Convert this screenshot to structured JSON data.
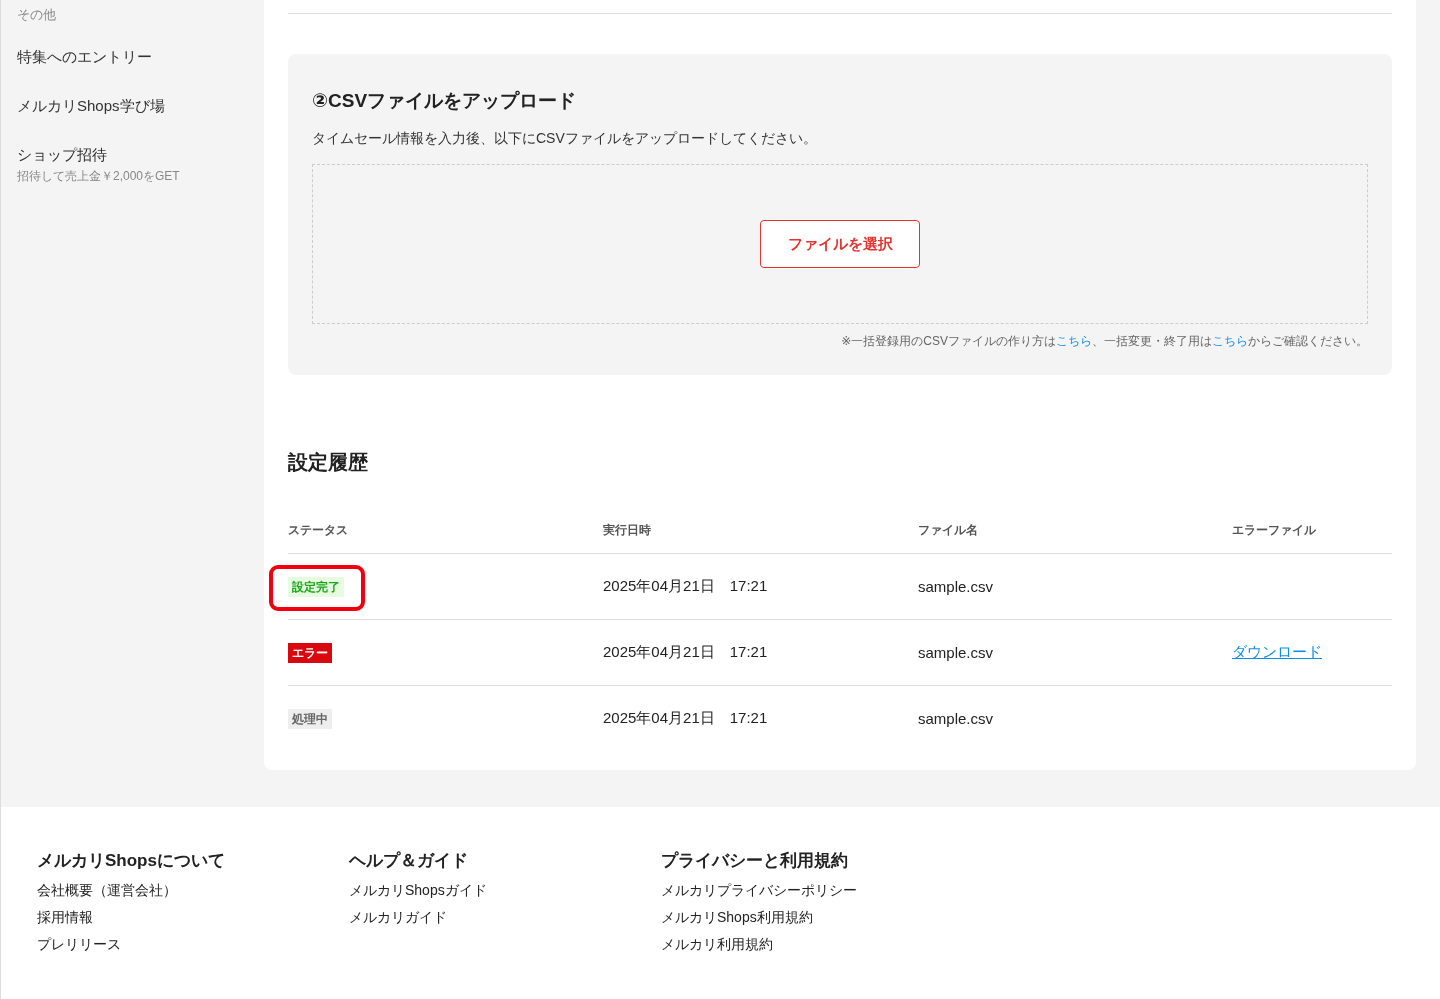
{
  "sidebar": {
    "section_label": "その他",
    "items": [
      {
        "label": "特集へのエントリー"
      },
      {
        "label": "メルカリShops学び場"
      },
      {
        "label": "ショップ招待",
        "sublabel": "招待して売上金￥2,000をGET"
      }
    ]
  },
  "upload": {
    "title": "②CSVファイルをアップロード",
    "description": "タイムセール情報を入力後、以下にCSVファイルをアップロードしてください。",
    "button": "ファイルを選択",
    "note": {
      "text_1": "※一括登録用のCSVファイルの作り方は",
      "link_1": "こちら",
      "text_2": "、一括変更・終了用は",
      "link_2": "こちら",
      "text_3": "からご確認ください。"
    }
  },
  "history": {
    "title": "設定履歴",
    "columns": [
      "ステータス",
      "実行日時",
      "ファイル名",
      "エラーファイル"
    ],
    "rows": [
      {
        "status": "設定完了",
        "kind": "success",
        "highlighted": true,
        "datetime": "2025年04月21日　17:21",
        "filename": "sample.csv"
      },
      {
        "status": "エラー",
        "kind": "error",
        "highlighted": false,
        "datetime": "2025年04月21日　17:21",
        "filename": "sample.csv",
        "error_file": "ダウンロード"
      },
      {
        "status": "処理中",
        "kind": "processing",
        "highlighted": false,
        "datetime": "2025年04月21日　17:21",
        "filename": "sample.csv"
      }
    ]
  },
  "footer": {
    "columns": [
      {
        "heading": "メルカリShopsについて",
        "links": [
          "会社概要（運営会社）",
          "採用情報",
          "プレリリース"
        ]
      },
      {
        "heading": "ヘルプ＆ガイド",
        "links": [
          "メルカリShopsガイド",
          "メルカリガイド"
        ]
      },
      {
        "heading": "プライバシーと利用規約",
        "links": [
          "メルカリプライバシーポリシー",
          "メルカリShops利用規約",
          "メルカリ利用規約"
        ]
      }
    ]
  }
}
